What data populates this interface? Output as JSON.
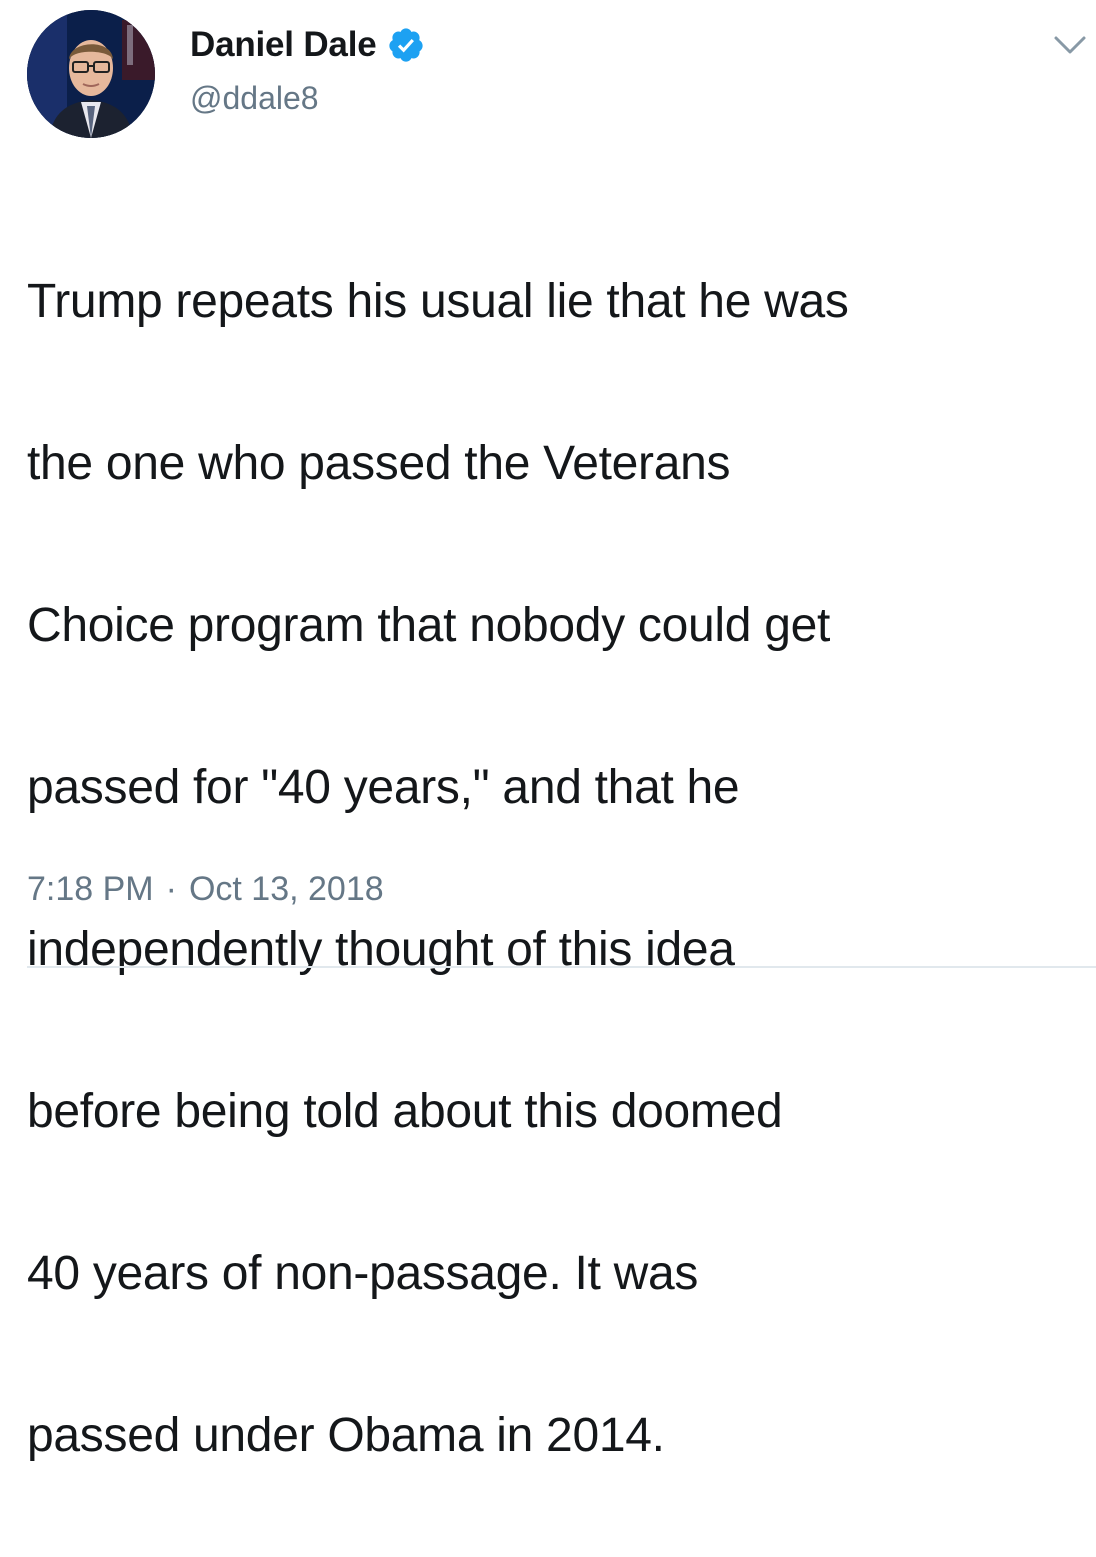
{
  "author": {
    "display_name": "Daniel Dale",
    "handle": "@ddale8",
    "verified": true
  },
  "icons": {
    "verified": "verified-badge-icon",
    "menu": "chevron-down-icon"
  },
  "tweet": {
    "lines": [
      "Trump repeats his usual lie that he was",
      "the one who passed the Veterans",
      "Choice program that nobody could get",
      "passed for \"40 years,\" and that he",
      "independently thought of this idea",
      "before being told about this doomed",
      "40 years of non-passage. It was",
      "passed under Obama in 2014."
    ],
    "time": "7:18 PM",
    "separator": "·",
    "date": "Oct 13, 2018"
  },
  "colors": {
    "verified_blue": "#1da1f2",
    "secondary_text": "#657786",
    "primary_text": "#14171a"
  }
}
